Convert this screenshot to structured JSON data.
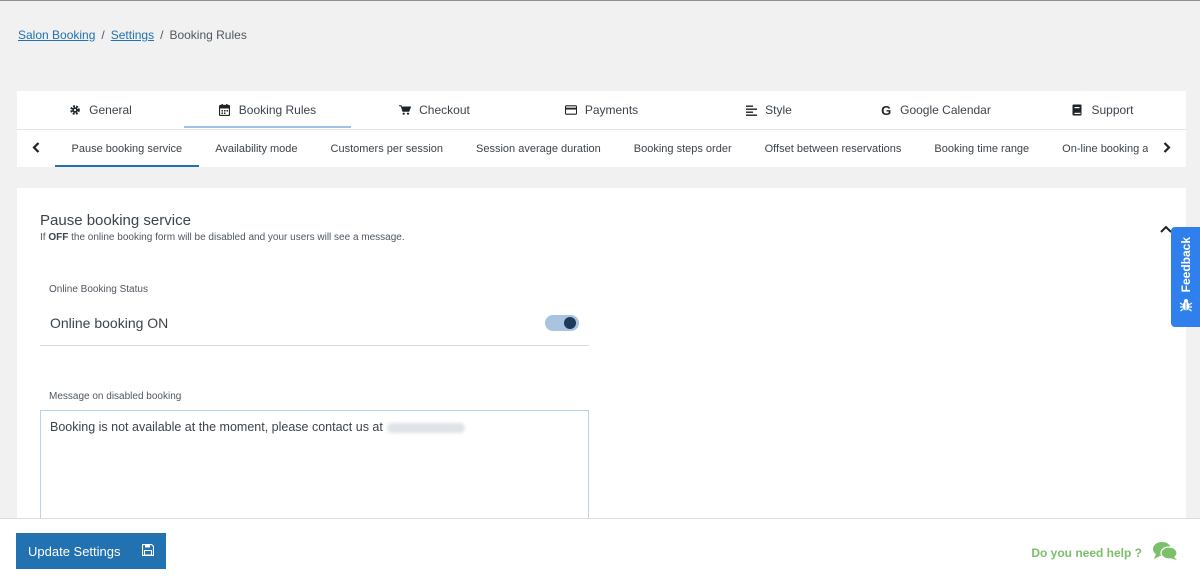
{
  "breadcrumb": {
    "items": [
      "Salon Booking",
      "Settings"
    ],
    "current": "Booking Rules",
    "separator": "/"
  },
  "main_tabs": [
    {
      "label": "General",
      "icon": "gear-icon"
    },
    {
      "label": "Booking Rules",
      "icon": "calendar-icon"
    },
    {
      "label": "Checkout",
      "icon": "cart-icon"
    },
    {
      "label": "Payments",
      "icon": "credit-card-icon"
    },
    {
      "label": "Style",
      "icon": "align-left-icon"
    },
    {
      "label": "Google Calendar",
      "icon": "google-icon"
    },
    {
      "label": "Support",
      "icon": "book-icon"
    }
  ],
  "active_main_tab": "Booking Rules",
  "sub_tabs": [
    "Pause booking service",
    "Availability mode",
    "Customers per session",
    "Session average duration",
    "Booking steps order",
    "Offset between reservations",
    "Booking time range",
    "On-line booking available da"
  ],
  "active_sub_tab": "Pause booking service",
  "section": {
    "title": "Pause booking service",
    "desc_prefix": "If ",
    "desc_bold": "OFF",
    "desc_suffix": " the online booking form will be disabled and your users will see a message."
  },
  "status": {
    "label": "Online Booking Status",
    "value": "Online booking ON",
    "toggle_on": true
  },
  "message": {
    "label": "Message on disabled booking",
    "text": "Booking is not available at the moment, please contact us at"
  },
  "footer": {
    "update_label": "Update Settings",
    "help_label": "Do you need help ?"
  },
  "feedback": {
    "label": "Feedback"
  },
  "colors": {
    "primary": "#2271b1",
    "feedback": "#2f80ed",
    "help": "#7bbf6a"
  }
}
